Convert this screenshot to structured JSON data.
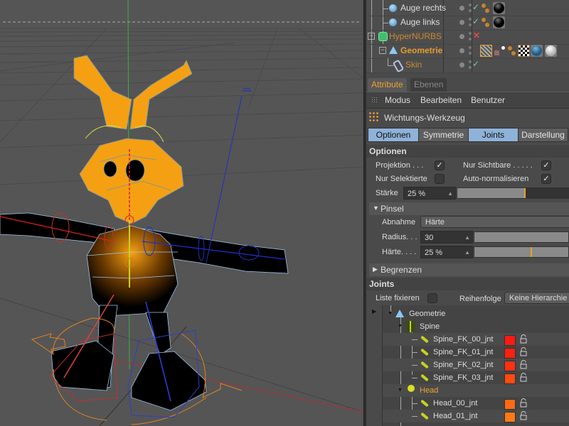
{
  "object_manager": {
    "rows": [
      {
        "name": "Auge rechts",
        "status": "check",
        "icon": "sphere-icon",
        "tags": [
          "vertex-map",
          "black-material"
        ]
      },
      {
        "name": "Auge links",
        "status": "check",
        "icon": "sphere-icon",
        "tags": [
          "vertex-map",
          "black-material"
        ]
      },
      {
        "name": "HyperNURBS",
        "status": "cross",
        "icon": "hypernurbs-icon",
        "tags": []
      },
      {
        "name": "Geometrie",
        "status": "none",
        "icon": "polygon-icon",
        "tags": [
          "weight-tag",
          "skin-tag",
          "vertex-map",
          "checker-material",
          "blue-material",
          "white-material"
        ]
      },
      {
        "name": "Skin",
        "status": "check",
        "icon": "skin-icon",
        "tags": []
      }
    ]
  },
  "attributes": {
    "tabs": [
      {
        "label": "Attribute",
        "active": true
      },
      {
        "label": "Ebenen",
        "active": false
      }
    ],
    "menu": [
      "Modus",
      "Bearbeiten",
      "Benutzer"
    ],
    "tool_title": "Wichtungs-Werkzeug",
    "subtabs": [
      {
        "label": "Optionen",
        "active": true
      },
      {
        "label": "Symmetrie",
        "active": false
      },
      {
        "label": "Joints",
        "active": true
      },
      {
        "label": "Darstellung",
        "active": false
      }
    ],
    "optionen": {
      "header": "Optionen",
      "projektion_label": "Projektion . . .",
      "projektion_checked": true,
      "nur_sichtbare_label": "Nur Sichtbare . . . . .",
      "nur_sichtbare_checked": true,
      "nur_selektierte_label": "Nur Selektierte",
      "nur_selektierte_checked": false,
      "auto_normalisieren_label": "Auto-normalisieren",
      "auto_normalisieren_checked": true,
      "staerke_label": "Stärke",
      "staerke_value": "25 %",
      "staerke_percent": 25
    },
    "pinsel": {
      "header": "Pinsel",
      "abnahme_label": "Abnahme",
      "abnahme_value": "Härte",
      "radius_label": "Radius. . .",
      "radius_value": "30",
      "haerte_label": "Härte. . . .",
      "haerte_value": "25 %",
      "haerte_percent": 25
    },
    "begrenzen": {
      "header": "Begrenzen"
    },
    "joints": {
      "header": "Joints",
      "liste_fixieren_label": "Liste fixieren",
      "liste_fixieren_checked": false,
      "reihenfolge_label": "Reihenfolge",
      "reihenfolge_value": "Keine Hierarchie",
      "tree": [
        {
          "name": "Geometrie",
          "level": 0,
          "type": "polygon",
          "expanded": true
        },
        {
          "name": "Spine",
          "level": 1,
          "type": "null-spine",
          "expanded": true
        },
        {
          "name": "Spine_FK_00_jnt",
          "level": 2,
          "type": "joint",
          "color": "#ff1a0f"
        },
        {
          "name": "Spine_FK_01_jnt",
          "level": 2,
          "type": "joint",
          "color": "#ff1f0f"
        },
        {
          "name": "Spine_FK_02_jnt",
          "level": 2,
          "type": "joint",
          "color": "#ff3010"
        },
        {
          "name": "Spine_FK_03_jnt",
          "level": 2,
          "type": "joint",
          "color": "#ff4a10"
        },
        {
          "name": "Head",
          "level": 1,
          "type": "null-head",
          "expanded": true,
          "highlight": true
        },
        {
          "name": "Head_00_jnt",
          "level": 2,
          "type": "joint",
          "color": "#ff6a12"
        },
        {
          "name": "Head_01_jnt",
          "level": 2,
          "type": "joint",
          "color": "#ff7a14"
        }
      ]
    }
  }
}
